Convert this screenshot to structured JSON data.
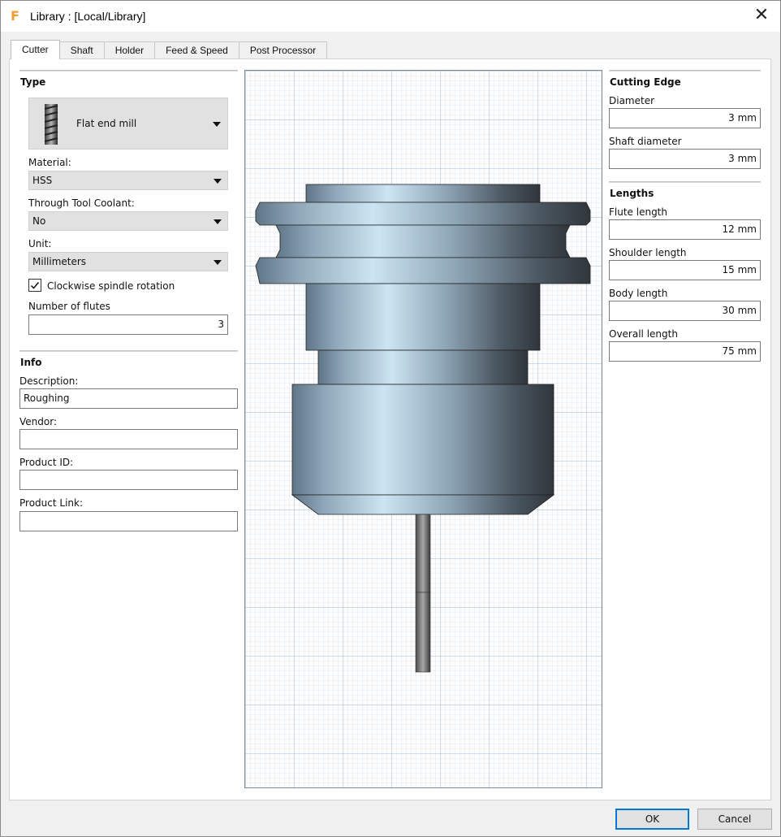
{
  "window": {
    "title": "Library :  [Local/Library]",
    "app_icon_glyph": "F"
  },
  "tabs": [
    {
      "label": "Cutter",
      "active": true
    },
    {
      "label": "Shaft"
    },
    {
      "label": "Holder"
    },
    {
      "label": "Feed & Speed"
    },
    {
      "label": "Post Processor"
    }
  ],
  "type_section": {
    "title": "Type",
    "tool_type": "Flat end mill",
    "tool_icon": "end-mill-icon",
    "material_label": "Material:",
    "material_value": "HSS",
    "coolant_label": "Through Tool Coolant:",
    "coolant_value": "No",
    "unit_label": "Unit:",
    "unit_value": "Millimeters",
    "clockwise_label": "Clockwise spindle rotation",
    "clockwise_checked": true,
    "flutes_label": "Number of flutes",
    "flutes_value": "3"
  },
  "info_section": {
    "title": "Info",
    "description_label": "Description:",
    "description_value": "Roughing",
    "vendor_label": "Vendor:",
    "vendor_value": "",
    "product_id_label": "Product ID:",
    "product_id_value": "",
    "product_link_label": "Product Link:",
    "product_link_value": ""
  },
  "cutting_edge": {
    "title": "Cutting Edge",
    "diameter_label": "Diameter",
    "diameter_value": "3 mm",
    "shaft_diameter_label": "Shaft diameter",
    "shaft_diameter_value": "3 mm"
  },
  "lengths": {
    "title": "Lengths",
    "flute_label": "Flute length",
    "flute_value": "12 mm",
    "shoulder_label": "Shoulder length",
    "shoulder_value": "15 mm",
    "body_label": "Body length",
    "body_value": "30 mm",
    "overall_label": "Overall length",
    "overall_value": "75 mm"
  },
  "buttons": {
    "ok": "OK",
    "cancel": "Cancel"
  },
  "colors": {
    "accent": "#0078d7",
    "grid_minor": "#c9dbe6",
    "grid_major": "#9fb9ca",
    "app_icon": "#f39c2f"
  }
}
